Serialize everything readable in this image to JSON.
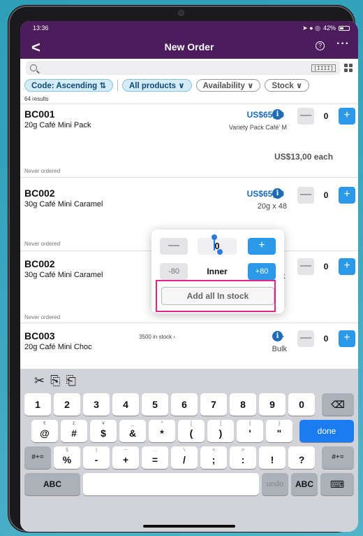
{
  "status": {
    "time": "13:36",
    "icons": "➤ ● ◎",
    "battery": "42%"
  },
  "nav": {
    "back": "<",
    "title": "New Order",
    "help": "?",
    "more": "···"
  },
  "search": {
    "placeholder": "",
    "barcode": "[IIII]"
  },
  "filters": {
    "sort": "Code: Ascending ⇅",
    "all_products": "All products ∨",
    "availability": "Availability ∨",
    "stock": "Stock ∨"
  },
  "results_count": "64 results",
  "products": [
    {
      "code": "BC001",
      "name": "20g Café Mini Pack",
      "price": "US$65,00",
      "sub": "Variety Pack Café' M",
      "each": "US$13,00 each",
      "never": "Never ordered",
      "qty": "0",
      "stock": ""
    },
    {
      "code": "BC002",
      "name": "30g Café Mini Caramel",
      "price": "US$65,00",
      "sub": "20g x 48",
      "each": "",
      "never": "Never ordered",
      "qty": "0",
      "stock": ""
    },
    {
      "code": "BC002",
      "name": "30g Café Mini Caramel",
      "price": "",
      "sub": "k",
      "each": "",
      "never": "Never ordered",
      "qty": "0",
      "stock": ""
    },
    {
      "code": "BC003",
      "name": "20g Café Mini Choc",
      "price": "$ -",
      "sub": "Bulk",
      "each": "",
      "never": "",
      "qty": "0",
      "stock": "3500 in stock ›"
    }
  ],
  "popover": {
    "minus": "—",
    "qty": "0",
    "plus": "+",
    "minus80": "-80",
    "inner": "Inner",
    "plus80": "+80",
    "add_all": "Add all In stock"
  },
  "stepper": {
    "minus": "—",
    "plus": "+"
  },
  "info": "i",
  "keyboard": {
    "toolbar": [
      "✂",
      "⎘",
      "⎗"
    ],
    "row1": [
      "1",
      "2",
      "3",
      "4",
      "5",
      "6",
      "7",
      "8",
      "9",
      "0"
    ],
    "row2": [
      [
        "€",
        "@"
      ],
      [
        "£",
        "#"
      ],
      [
        "¥",
        "$"
      ],
      [
        "_",
        "&"
      ],
      [
        "^",
        "*"
      ],
      [
        "[",
        "("
      ],
      [
        "]",
        ")"
      ],
      [
        "{",
        "'"
      ],
      [
        "}",
        "\""
      ]
    ],
    "row3": [
      [
        "§",
        "%"
      ],
      [
        "|",
        "-"
      ],
      [
        "~",
        "+"
      ],
      [
        "…",
        "="
      ],
      [
        "\\",
        "/"
      ],
      [
        "<",
        ";"
      ],
      [
        ">",
        ":"
      ],
      [
        "",
        "!"
      ],
      [
        "",
        "?"
      ]
    ],
    "delete": "⌫",
    "done": "done",
    "shift": "#+=",
    "abc": "ABC",
    "undo": "undo",
    "kb_icon": "⌨"
  }
}
